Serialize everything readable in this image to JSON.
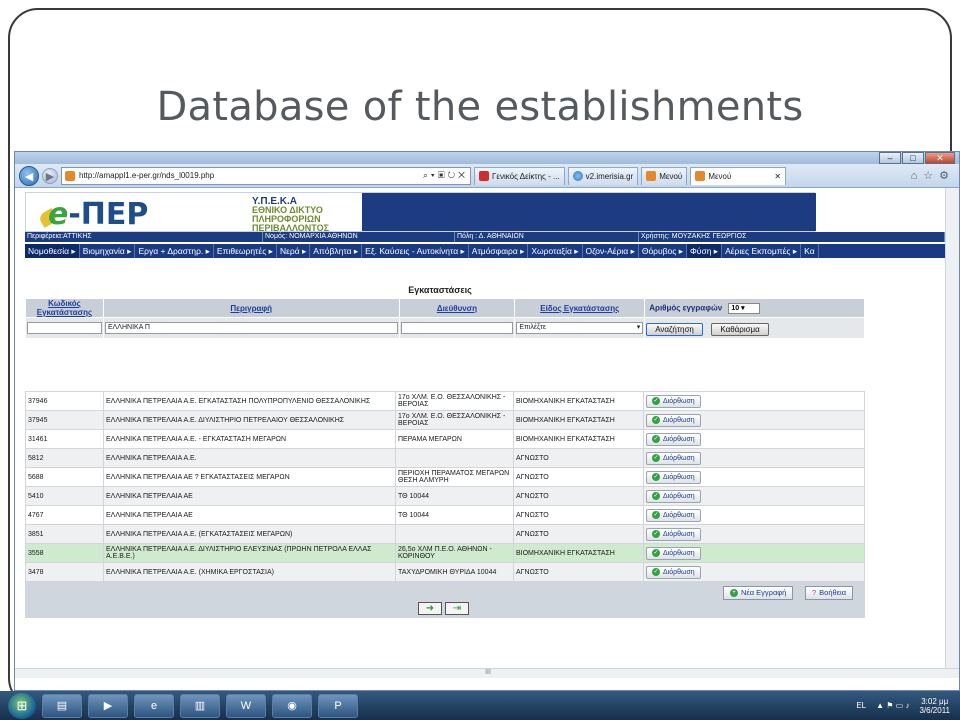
{
  "slide": {
    "title": "Database of the establishments"
  },
  "browser": {
    "url": "http://amappl1.e-per.gr/nds_l0019.php",
    "tabs": [
      {
        "label": "Γενικός Δείκτης - ..."
      },
      {
        "label": "v2.imerisia.gr"
      },
      {
        "label": "Μενού"
      },
      {
        "label": "Μενού"
      }
    ],
    "scroll_marker": "III"
  },
  "site": {
    "logo_text": "-ΠΕΡ",
    "logo_letter": "e",
    "org_abbr": "Υ.Π.Ε.Κ.Α",
    "org_lines": [
      "ΕΘΝΙΚΟ ΔΙΚΤΥΟ",
      "ΠΛΗΡΟΦΟΡΙΩΝ",
      "ΠΕΡΙΒΑΛΛΟΝΤΟΣ"
    ],
    "info": {
      "region": "Περιφέρεια:ΑΤΤΙΚΗΣ",
      "prefecture": "Νομός: ΝΟΜΑΡΧΙΑ ΑΘΗΝΩΝ",
      "city": "Πόλη : Δ. ΑΘΗΝΑΙΩΝ",
      "user": "Χρήστης: ΜΟΥΖΑΚΗΣ ΓΕΩΡΓΙΟΣ"
    },
    "menu": [
      "Νομοθεσία ▸",
      "Βιομηχανία ▸",
      "Εργα + Δραστηρ. ▸",
      "Επιθεωρητές ▸",
      "Νερά ▸",
      "Απόβλητα ▸",
      "Εξ. Καύσεις - Αυτοκίνητα ▸",
      "Ατμόσφαιρα ▸",
      "Χωροταξία ▸",
      "Οζον-Αέρια ▸",
      "Θόρυβος ▸",
      "Φύση ▸",
      "Αέριες Εκπομπές ▸",
      "Κα"
    ]
  },
  "page": {
    "heading": "Εγκαταστάσεις",
    "columns": {
      "code": "Κωδικός Εγκατάστασης",
      "description": "Περιγραφή",
      "address": "Διεύθυνση",
      "type": "Είδος Εγκατάστασης",
      "records": "Αριθμός εγγραφών"
    },
    "filter": {
      "description_value": "ΕΛΛΗΝΙΚΑ Π",
      "type_value": "Επιλέξτε",
      "records_value": "10"
    },
    "search_button": "Αναζήτηση",
    "clear_button": "Καθάρισμα",
    "edit_label": "Διόρθωση",
    "new_record": "Νέα Εγγραφή",
    "help": "Βοήθεια",
    "rows": [
      {
        "code": "37946",
        "desc": "ΕΛΛΗΝΙΚΑ ΠΕΤΡΕΛΑΙΑ Α.Ε. ΕΓΚΑΤΑΣΤΑΣΗ ΠΟΛΥΠΡΟΠΥΛΕΝΙΟ ΘΕΣΣΑΛΟΝΙΚΗΣ",
        "addr": "17ο ΧΛΜ. Ε.Ο. ΘΕΣΣΑΛΟΝΙΚΗΣ - ΒΕΡΟΙΑΣ",
        "type": "ΒΙΟΜΗΧΑΝΙΚΗ ΕΓΚΑΤΑΣΤΑΣΗ"
      },
      {
        "code": "37945",
        "desc": "ΕΛΛΗΝΙΚΑ ΠΕΤΡΕΛΑΙΑ Α.Ε. ΔΙΥΛΙΣΤΗΡΙΟ ΠΕΤΡΕΛΑΙΟΥ ΘΕΣΣΑΛΟΝΙΚΗΣ",
        "addr": "17ο ΧΛΜ. Ε.Ο. ΘΕΣΣΑΛΟΝΙΚΗΣ - ΒΕΡΟΙΑΣ",
        "type": "ΒΙΟΜΗΧΑΝΙΚΗ ΕΓΚΑΤΑΣΤΑΣΗ"
      },
      {
        "code": "31461",
        "desc": "ΕΛΛΗΝΙΚΑ ΠΕΤΡΕΛΑΙΑ Α.Ε. - ΕΓΚΑΤΑΣΤΑΣΗ ΜΕΓΑΡΩΝ",
        "addr": "ΠΕΡΑΜΑ ΜΕΓΑΡΩΝ",
        "type": "ΒΙΟΜΗΧΑΝΙΚΗ ΕΓΚΑΤΑΣΤΑΣΗ"
      },
      {
        "code": "5812",
        "desc": "ΕΛΛΗΝΙΚΑ ΠΕΤΡΕΛΑΙΑ Α.Ε.",
        "addr": "",
        "type": "ΑΓΝΩΣΤΟ"
      },
      {
        "code": "5688",
        "desc": "ΕΛΛΗΝΙΚΑ ΠΕΤΡΕΛΑΙΑ ΑΕ ? ΕΓΚΑΤΑΣΤΑΣΕΙΣ ΜΕΓΑΡΩΝ",
        "addr": "ΠΕΡΙΟΧΗ ΠΕΡΑΜΑΤΟΣ ΜΕΓΑΡΩΝ ΘΕΣΗ ΑΛΜΥΡΗ",
        "type": "ΑΓΝΩΣΤΟ"
      },
      {
        "code": "5410",
        "desc": "ΕΛΛΗΝΙΚΑ ΠΕΤΡΕΛΑΙΑ ΑΕ",
        "addr": "ΤΘ 10044",
        "type": "ΑΓΝΩΣΤΟ"
      },
      {
        "code": "4767",
        "desc": "ΕΛΛΗΝΙΚΑ ΠΕΤΡΕΛΑΙΑ ΑΕ",
        "addr": "ΤΘ 10044",
        "type": "ΑΓΝΩΣΤΟ"
      },
      {
        "code": "3851",
        "desc": "ΕΛΛΗΝΙΚΑ ΠΕΤΡΕΛΑΙΑ Α.Ε. (ΕΓΚΑΤΑΣΤΑΣΕΙΣ ΜΕΓΑΡΩΝ)",
        "addr": "",
        "type": "ΑΓΝΩΣΤΟ"
      },
      {
        "code": "3558",
        "desc": "ΕΛΛΗΝΙΚΑ ΠΕΤΡΕΛΑΙΑ Α.Ε. ΔΙΥΛΙΣΤΗΡΙΟ ΕΛΕΥΣΙΝΑΣ (ΠΡΩΗΝ ΠΕΤΡΟΛΑ ΕΛΛΑΣ Α.Ε.Β.Ε.)",
        "addr": "26,5ο ΧΛΜ Π.Ε.Ο. ΑΘΗΝΩΝ - ΚΟΡΙΝΘΟΥ",
        "type": "ΒΙΟΜΗΧΑΝΙΚΗ ΕΓΚΑΤΑΣΤΑΣΗ"
      },
      {
        "code": "3478",
        "desc": "ΕΛΛΗΝΙΚΑ ΠΕΤΡΕΛΑΙΑ Α.Ε. (ΧΗΜΙΚΑ ΕΡΓΟΣΤΑΣΙΑ)",
        "addr": "ΤΑΧΥΔΡΟΜΙΚΗ ΘΥΡΙΔΑ 10044",
        "type": "ΑΓΝΩΣΤΟ"
      }
    ]
  },
  "taskbar": {
    "lang": "EL",
    "time": "3:02 μμ",
    "date": "3/6/2011"
  },
  "colors": {
    "site_navy": "#1d3b80",
    "link_blue": "#1d3ea0",
    "logo_green": "#3aa540"
  }
}
